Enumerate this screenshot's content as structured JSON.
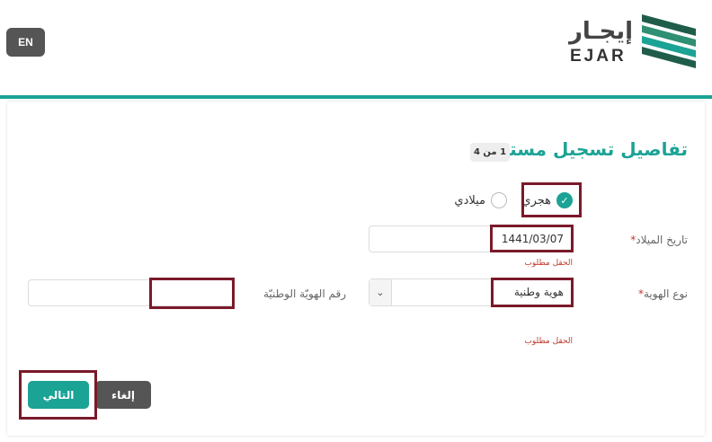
{
  "header": {
    "lang_button": "EN",
    "logo_arabic": "إيجـار",
    "logo_english": "EJAR"
  },
  "form": {
    "title": "تفاصيل تسجيل مستخدم",
    "step": "1 من 4",
    "calendar": {
      "options": [
        {
          "label": "هجري",
          "checked": true
        },
        {
          "label": "ميلادي",
          "checked": false
        }
      ]
    },
    "birth_date": {
      "label": "تاريخ الميلاد",
      "required_mark": "*",
      "value": "1441/03/07",
      "error": "الحقل مطلوب"
    },
    "id_type": {
      "label": "نوع الهوية",
      "required_mark": "*",
      "selected": "هوية وطنية",
      "error": "الحقل مطلوب"
    },
    "id_number": {
      "label": "رقم الهويّة الوطنيّة",
      "value": ""
    },
    "buttons": {
      "next": "التالي",
      "cancel": "إلغاء"
    }
  },
  "colors": {
    "accent": "#1ba395",
    "dark_button": "#555555",
    "error": "#c0392b",
    "highlight": "#7a1a2a"
  }
}
